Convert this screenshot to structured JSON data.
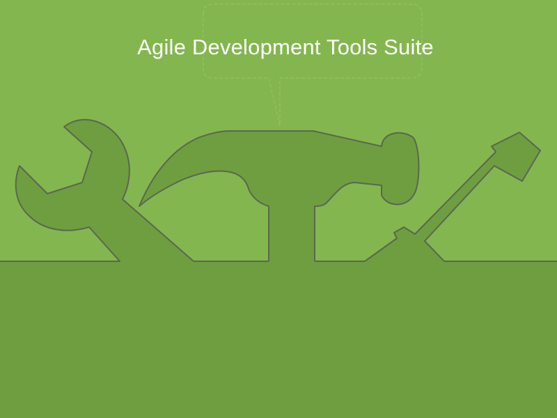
{
  "slide": {
    "title": "Agile Development Tools Suite"
  },
  "colors": {
    "background": "#84b64f",
    "ground": "#6e9e40",
    "tool_fill": "#6e9e40",
    "outline": "#5b6650",
    "faint_outline": "#97c16a",
    "title_text": "#ffffff"
  },
  "icons": [
    "wrench-icon",
    "hammer-icon",
    "screwdriver-icon"
  ]
}
